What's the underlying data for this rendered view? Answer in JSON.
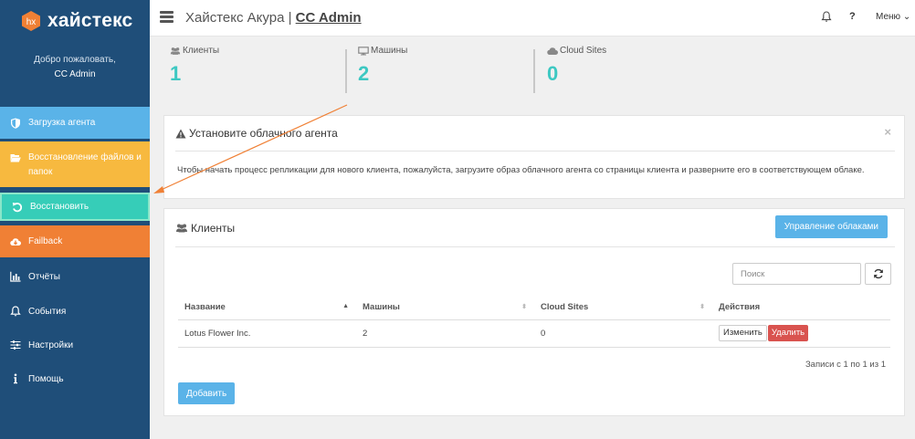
{
  "brand": {
    "logo_glyph": "hx",
    "name": "хайстекс",
    "accent": "#f08035"
  },
  "welcome": {
    "greeting": "Добро пожаловать,",
    "user": "CC Admin"
  },
  "sidebar": {
    "items": [
      {
        "label": "Загрузка агента",
        "icon": "shield-icon",
        "color": "#5ab3e8"
      },
      {
        "label": "Восстановление файлов и папок",
        "icon": "folder-open-icon",
        "color": "#f7b93f"
      },
      {
        "label": "Восстановить",
        "icon": "undo-icon",
        "color": "#36cdb8",
        "active": true
      },
      {
        "label": "Failback",
        "icon": "cloud-download-icon",
        "color": "#f08035"
      },
      {
        "label": "Отчёты",
        "icon": "bar-chart-icon"
      },
      {
        "label": "События",
        "icon": "bell-icon"
      },
      {
        "label": "Настройки",
        "icon": "sliders-icon"
      },
      {
        "label": "Помощь",
        "icon": "info-icon"
      }
    ]
  },
  "header": {
    "app": "Хайстекс Акура |",
    "org": "CC Admin",
    "help": "?",
    "menu": "Меню"
  },
  "stats": [
    {
      "label": "Клиенты",
      "value": "1",
      "icon": "users-icon"
    },
    {
      "label": "Машины",
      "value": "2",
      "icon": "monitor-icon"
    },
    {
      "label": "Cloud Sites",
      "value": "0",
      "icon": "cloud-icon"
    }
  ],
  "alert": {
    "title": "Установите облачного агента",
    "close": "×",
    "text": "Чтобы начать процесс репликации для нового клиента, пожалуйста, загрузите образ облачного агента со страницы клиента и разверните его в соответствующем облаке."
  },
  "clients": {
    "title": "Клиенты",
    "manage_button": "Управление облаками",
    "search_placeholder": "Поиск",
    "columns": [
      "Название",
      "Машины",
      "Cloud Sites",
      "Действия"
    ],
    "rows": [
      {
        "name": "Lotus Flower Inc.",
        "machines": "2",
        "sites": "0",
        "edit": "Изменить",
        "delete": "Удалить"
      }
    ],
    "records": "Записи с 1 по 1 из 1",
    "add_button": "Добавить"
  }
}
